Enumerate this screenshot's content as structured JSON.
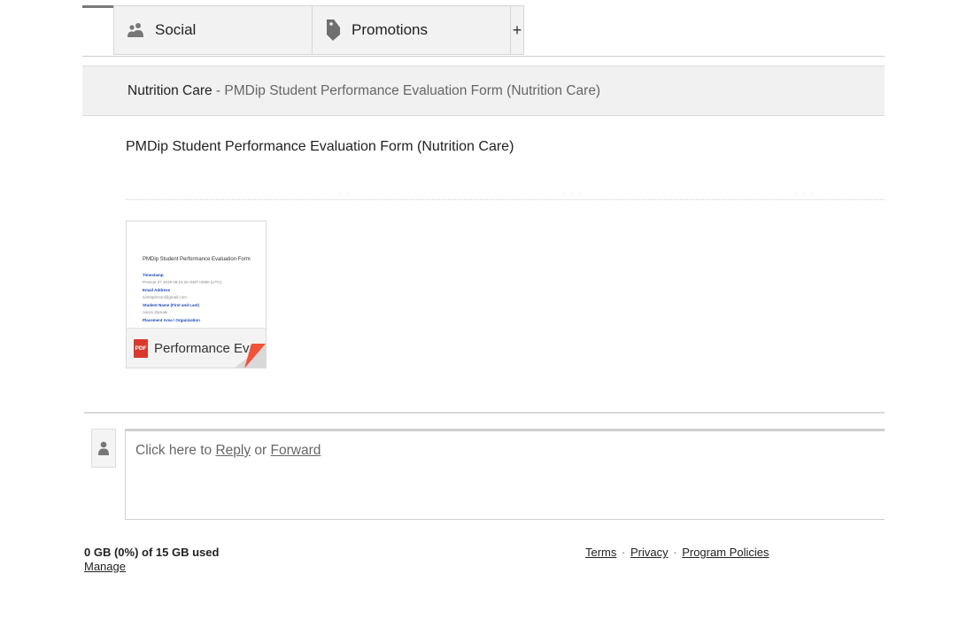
{
  "tabs": {
    "items": [
      {
        "label": "Social",
        "icon": "people-icon"
      },
      {
        "label": "Promotions",
        "icon": "tag-icon"
      }
    ],
    "add_label": "+"
  },
  "subject_bar": {
    "label": "Nutrition Care",
    "separator": " - ",
    "title": "PMDip Student Performance Evaluation Form (Nutrition Care)"
  },
  "message": {
    "heading": "PMDip Student Performance Evaluation Form (Nutrition Care)"
  },
  "attachment": {
    "name": "Performance Eva...",
    "type_badge": "PDF",
    "preview": {
      "title": "PMDip Student Performance Evaluation Form",
      "lines": [
        {
          "kind": "lbl",
          "text": "Timestamp"
        },
        {
          "kind": "val",
          "text": "Prescar 27 2019 09:15:26 GMT+0000 (UTC)"
        },
        {
          "kind": "lbl",
          "text": "Email Address"
        },
        {
          "kind": "val",
          "text": "someperson@gmail.com"
        },
        {
          "kind": "lbl",
          "text": "Student Name (First and Last)"
        },
        {
          "kind": "val",
          "text": "Aaron Zamaki"
        },
        {
          "kind": "lbl",
          "text": "Placement Area / Organization"
        }
      ]
    },
    "colors": {
      "pdf_red": "#d9382c",
      "fold_red": "#f0533a"
    }
  },
  "reply": {
    "prefix": "Click here to ",
    "reply_link": "Reply",
    "middle": " or ",
    "forward_link": "Forward"
  },
  "footer": {
    "storage_used": "0 GB (0%) of 15 GB used",
    "manage_link": "Manage",
    "links": [
      "Terms",
      "Privacy",
      "Program Policies"
    ],
    "separator": "·"
  }
}
